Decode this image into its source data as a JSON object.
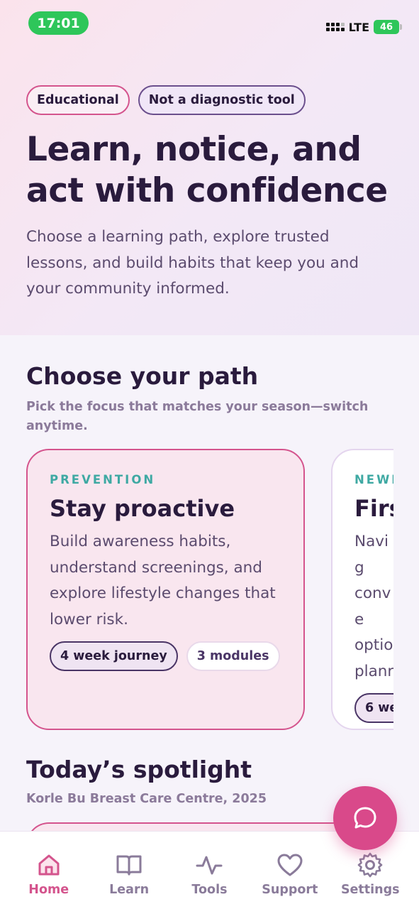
{
  "status_bar": {
    "time": "17:01",
    "network": "LTE",
    "battery": "46"
  },
  "hero": {
    "chips": [
      "Educational",
      "Not a diagnostic tool"
    ],
    "title": "Learn, notice, and act with confidence",
    "subtitle": "Choose a learning path, explore trusted lessons, and build habits that keep you and your community informed."
  },
  "paths": {
    "title": "Choose your path",
    "subtitle": "Pick the focus that matches your season—switch anytime.",
    "cards": [
      {
        "eyebrow": "PREVENTION",
        "title": "Stay proactive",
        "description": "Build awareness habits, understand screenings, and explore lifestyle changes that lower risk.",
        "tags": [
          "4 week journey",
          "3 modules"
        ]
      },
      {
        "eyebrow": "NEWI",
        "title": "Firs",
        "description": "Navig conve optio planr",
        "tags": [
          "6 we"
        ]
      }
    ]
  },
  "spotlight": {
    "title": "Today’s spotlight",
    "subtitle": "Korle Bu Breast Care Centre, 2025"
  },
  "tabbar": {
    "items": [
      {
        "label": "Home",
        "icon": "home-icon",
        "active": true
      },
      {
        "label": "Learn",
        "icon": "book-icon",
        "active": false
      },
      {
        "label": "Tools",
        "icon": "pulse-icon",
        "active": false
      },
      {
        "label": "Support",
        "icon": "heart-icon",
        "active": false
      },
      {
        "label": "Settings",
        "icon": "gear-icon",
        "active": false
      }
    ]
  },
  "fab": {
    "icon": "chat-bubble-icon"
  },
  "colors": {
    "accent": "#d9498a",
    "teal": "#3fa9a3",
    "ink": "#2a1b3d",
    "status_green": "#2ec65a"
  }
}
